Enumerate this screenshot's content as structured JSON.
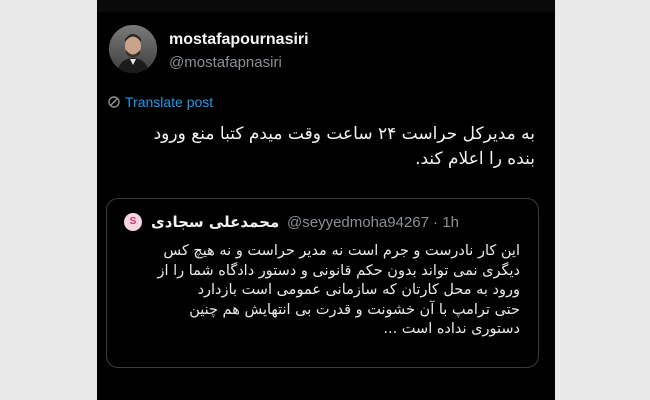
{
  "author": {
    "display_name": "mostafapournasiri",
    "handle": "@mostafapnasiri"
  },
  "translate_link": "Translate post",
  "tweet": {
    "lines": [
      "به مدیرکل حراست ۲۴ ساعت وقت میدم کتبا منع ورود",
      "بنده را اعلام کند."
    ]
  },
  "quote": {
    "avatar_letter": "S",
    "name": "محمدعلی سجادی",
    "handle": "@seyyedmoha94267",
    "separator": "·",
    "time": "1h",
    "lines": [
      "این کار نادرست و جرم است نه مدیر حراست و نه هیچ کس",
      "دیگری نمی تواند بدون حکم قانونی و دستور دادگاه شما را از",
      "ورود به محل کارتان که سازمانی عمومی است  بازدارد",
      "حتی ترامپ با آن خشونت و قدرت بی انتهایش  هم چنین",
      "دستوری نداده است ..."
    ]
  },
  "colors": {
    "background": "#000000",
    "link": "#1d9bf0",
    "secondary_text": "#8b9096",
    "border": "#3a3d41",
    "primary_text": "#f2f2f2"
  },
  "icons": {
    "translate": "translate-icon",
    "avatar": "profile-photo"
  }
}
